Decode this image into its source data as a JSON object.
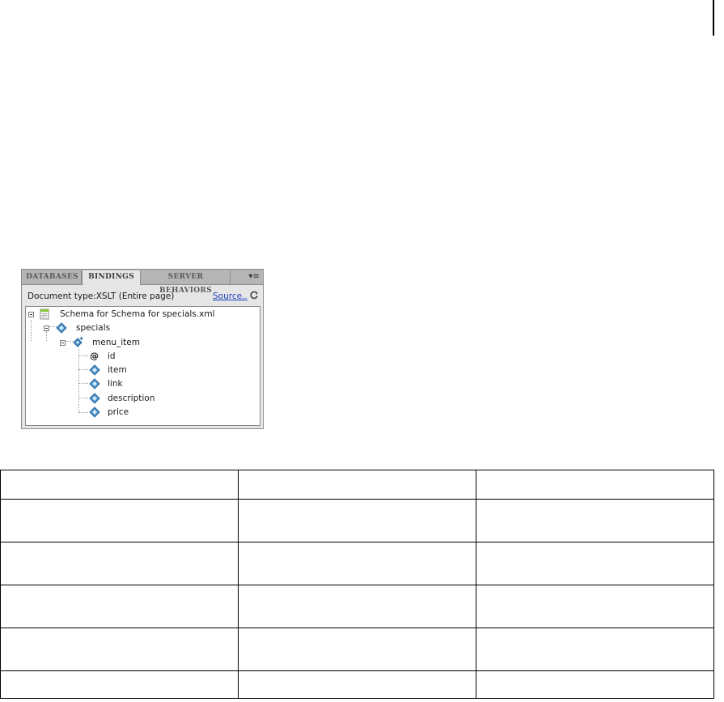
{
  "tabs": [
    "DATABASES",
    "BINDINGS",
    "SERVER BEHAVIORS"
  ],
  "menu_glyph": "▾≡",
  "doc_type": "Document type:XSLT (Entire page)",
  "source_link": "Source..",
  "tree": {
    "root": "Schema for Schema for specials.xml",
    "level1": "specials",
    "level2": "menu_item",
    "attribute": "id",
    "children": [
      "item",
      "link",
      "description",
      "price"
    ]
  },
  "icons": {
    "refresh": "refresh-icon",
    "root": "schema-file-icon",
    "element": "element-icon",
    "repeating": "repeating-element-icon",
    "attribute": "attribute-icon"
  },
  "colors": {
    "element_icon": "#4a90c8",
    "link": "#1f3fbf"
  },
  "table": {
    "rows": 6,
    "columns": 3
  }
}
